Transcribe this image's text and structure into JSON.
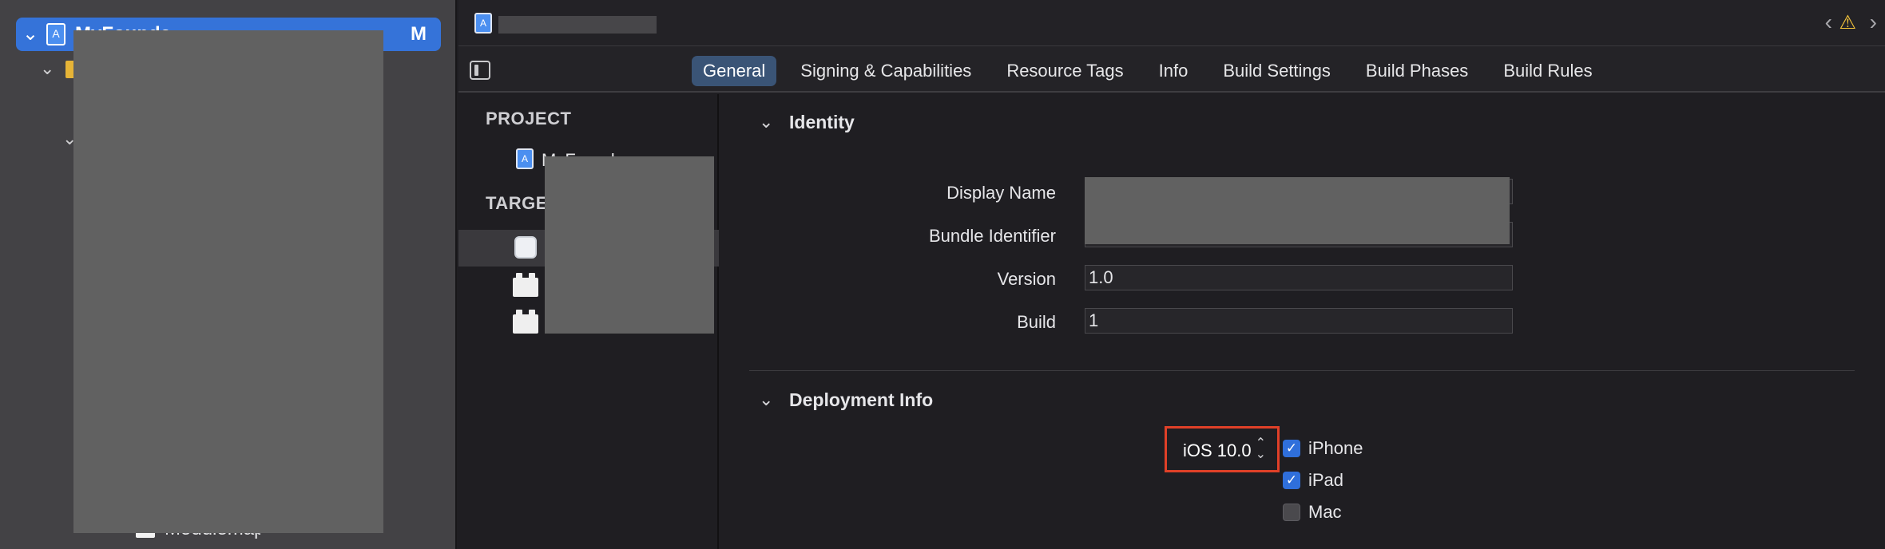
{
  "navigator": {
    "project_name": "MyFoundation",
    "project_badge": "M",
    "bottom_file_label": "Modulemap"
  },
  "jumpbar": {
    "back_glyph": "‹",
    "warning_glyph": "⚠",
    "forward_glyph": "›"
  },
  "tabs": [
    {
      "label": "General",
      "active": true
    },
    {
      "label": "Signing & Capabilities"
    },
    {
      "label": "Resource Tags"
    },
    {
      "label": "Info"
    },
    {
      "label": "Build Settings"
    },
    {
      "label": "Build Phases"
    },
    {
      "label": "Build Rules"
    }
  ],
  "target_list": {
    "project_heading": "PROJECT",
    "project_item": "MyFoundation",
    "targets_heading": "TARGETS"
  },
  "identity": {
    "title": "Identity",
    "display_name_label": "Display Name",
    "bundle_identifier_label": "Bundle Identifier",
    "version_label": "Version",
    "version_value": "1.0",
    "build_label": "Build",
    "build_value": "1"
  },
  "deployment": {
    "title": "Deployment Info",
    "ios_version": "iOS 10.0",
    "devices": [
      {
        "label": "iPhone",
        "checked": true
      },
      {
        "label": "iPad",
        "checked": true
      },
      {
        "label": "Mac",
        "checked": false
      }
    ]
  },
  "colors": {
    "accent": "#3573d9",
    "tab_active": "#3a5476",
    "highlight_box": "#e04028",
    "warning": "#f3c33a"
  },
  "icons": {
    "project_file": "xcode-project-icon",
    "folder": "folder-icon",
    "sidebar_toggle": "sidebar-toggle-icon",
    "app_target": "app-target-icon",
    "framework_target": "framework-target-icon",
    "warning": "warning-icon",
    "checkbox": "checkbox-icon"
  }
}
